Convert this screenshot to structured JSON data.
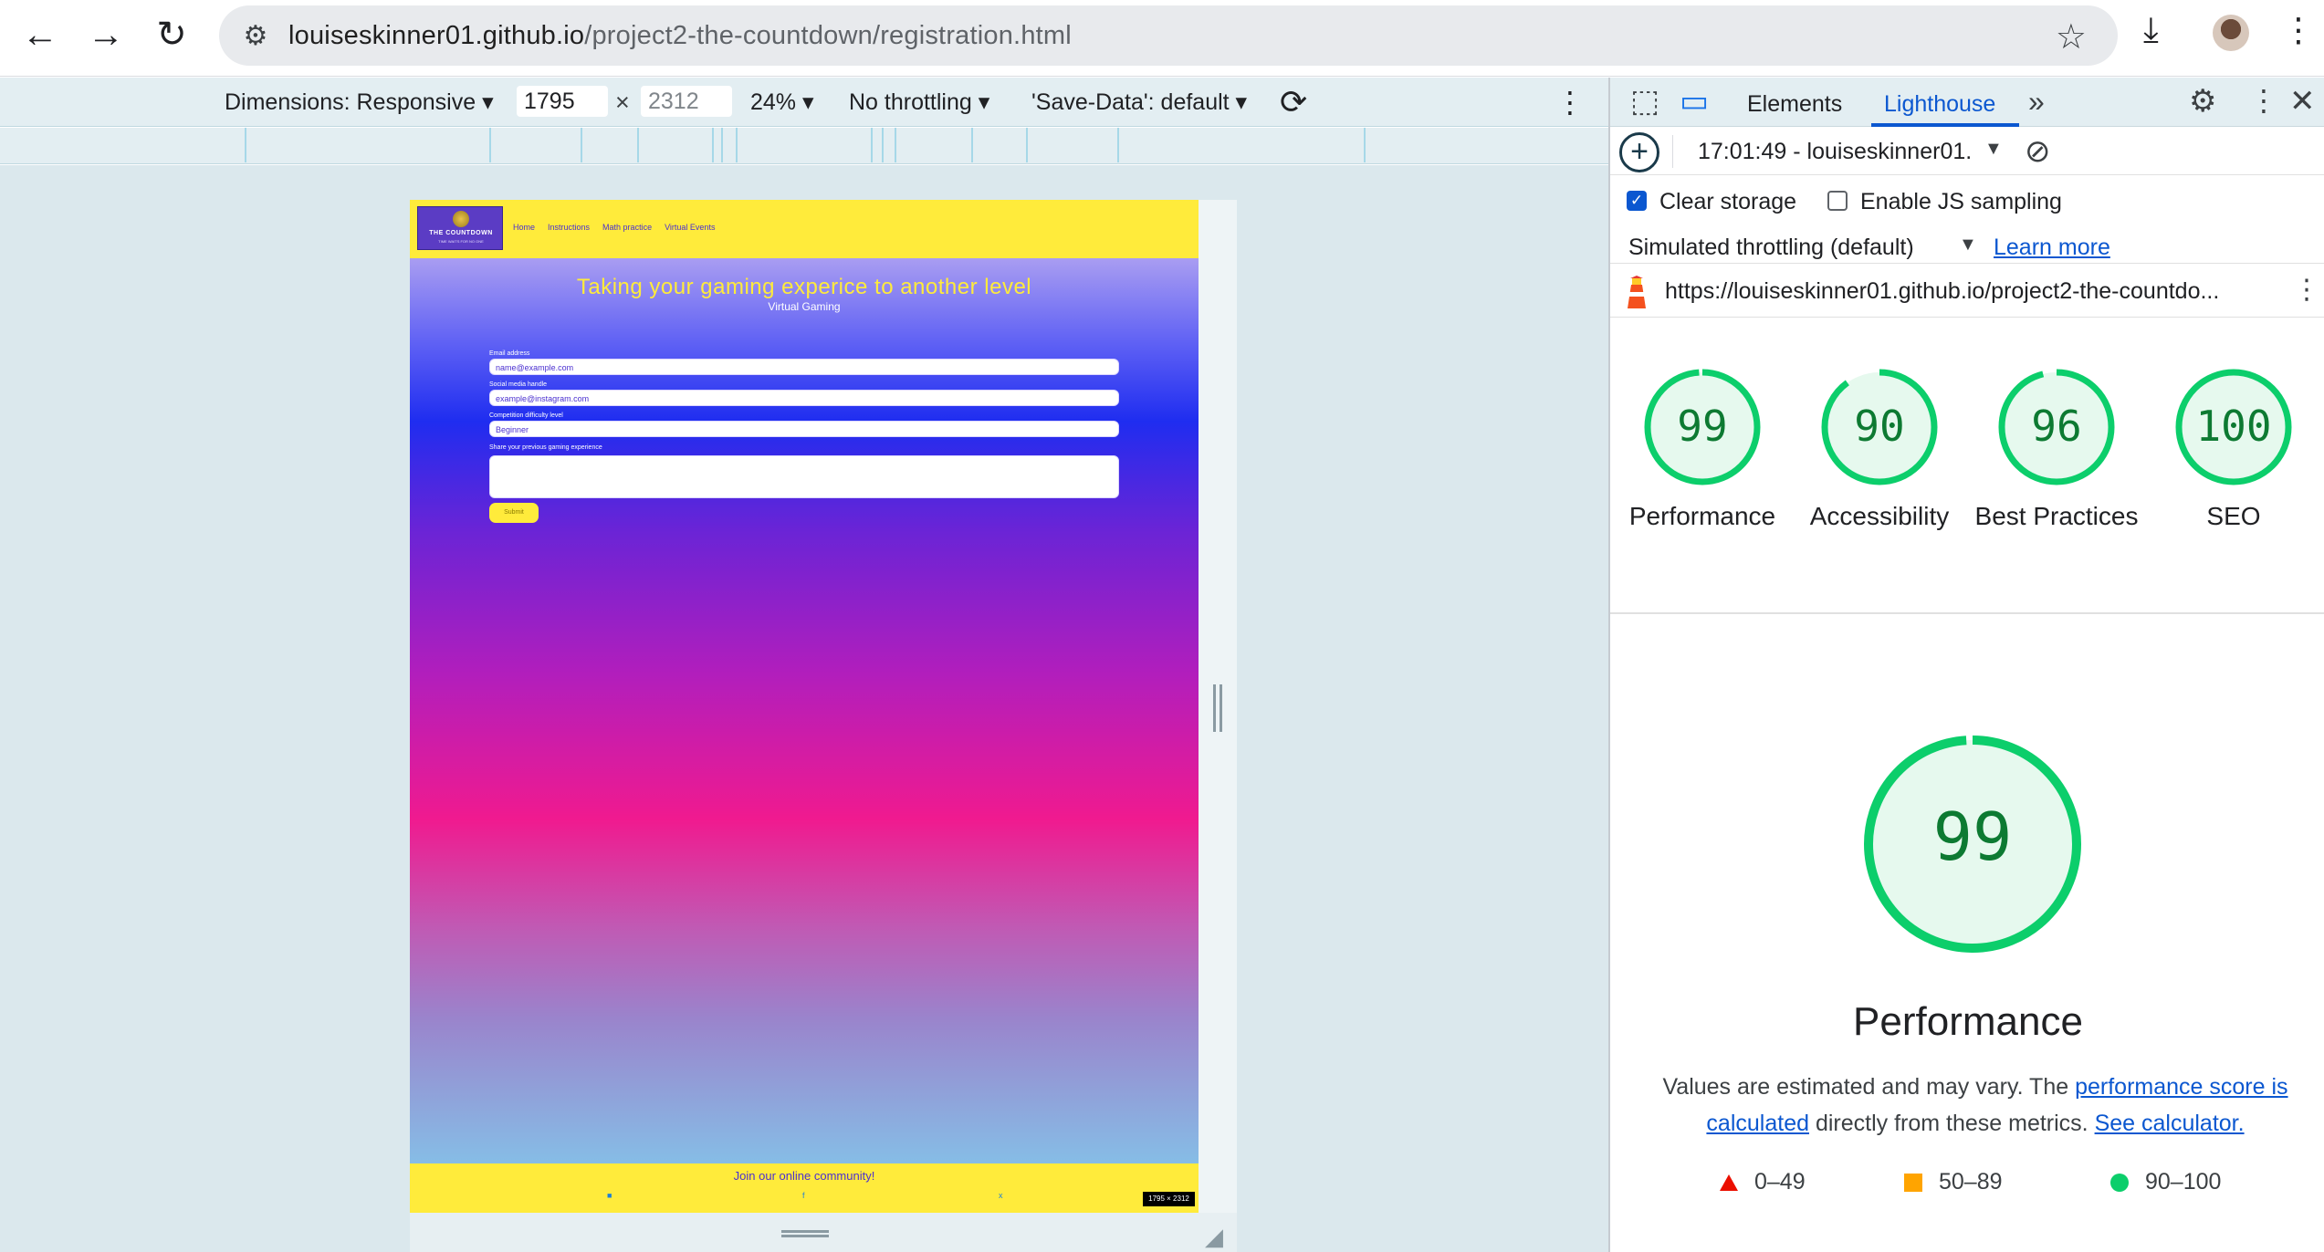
{
  "browser": {
    "url_host": "louiseskinner01.github.io",
    "url_path": "/project2-the-countdown/registration.html"
  },
  "device_toolbar": {
    "dimensions_label": "Dimensions: Responsive ▾",
    "width": "1795",
    "x": "×",
    "height": "2312",
    "zoom": "24% ▾",
    "throttling": "No throttling ▾",
    "save_data": "'Save-Data': default ▾"
  },
  "site": {
    "logo_text": "THE COUNTDOWN",
    "logo_subtext": "TIME WAITS FOR NO ONE",
    "nav": [
      "Home",
      "Instructions",
      "Math practice",
      "Virtual Events"
    ],
    "hero_title": "Taking your gaming experice to another level",
    "hero_subtitle": "Virtual Gaming",
    "form": {
      "email_label": "Email address",
      "email_placeholder": "name@example.com",
      "social_label": "Social media handle",
      "social_placeholder": "example@instagram.com",
      "level_label": "Competition difficulty level",
      "level_value": "Beginner",
      "experience_label": "Share your previous gaming experience",
      "submit_label": "Submit"
    },
    "footer_title": "Join our online community!",
    "footer_icons": [
      "instagram-icon",
      "facebook-icon",
      "x-icon"
    ],
    "size_badge": "1795 × 2312"
  },
  "devtools": {
    "tabs": [
      "Elements",
      "Lighthouse"
    ],
    "report_label": "17:01:49 - louiseskinner01.",
    "clear_storage_label": "Clear storage",
    "js_sampling_label": "Enable JS sampling",
    "throttling_label": "Simulated throttling (default)",
    "learn_more": "Learn more",
    "audited_url": "https://louiseskinner01.github.io/project2-the-countdo..."
  },
  "lighthouse": {
    "scores": [
      {
        "label": "Performance",
        "value": 99
      },
      {
        "label": "Accessibility",
        "value": 90
      },
      {
        "label": "Best Practices",
        "value": 96
      },
      {
        "label": "SEO",
        "value": 100
      }
    ],
    "main_score": 99,
    "main_label": "Performance",
    "note_prefix": "Values are estimated and may vary. The ",
    "note_link1": "performance score is calculated",
    "note_middle": " directly from these metrics. ",
    "note_link2": "See calculator.",
    "legend": [
      {
        "range": "0–49",
        "color": "#eb0f00"
      },
      {
        "range": "50–89",
        "color": "#ffa400"
      },
      {
        "range": "90–100",
        "color": "#0cce6b"
      }
    ],
    "colors": {
      "pass": "#0cce6b",
      "pass_fill": "#e6f9ee",
      "pass_text": "#0d7a32"
    }
  }
}
